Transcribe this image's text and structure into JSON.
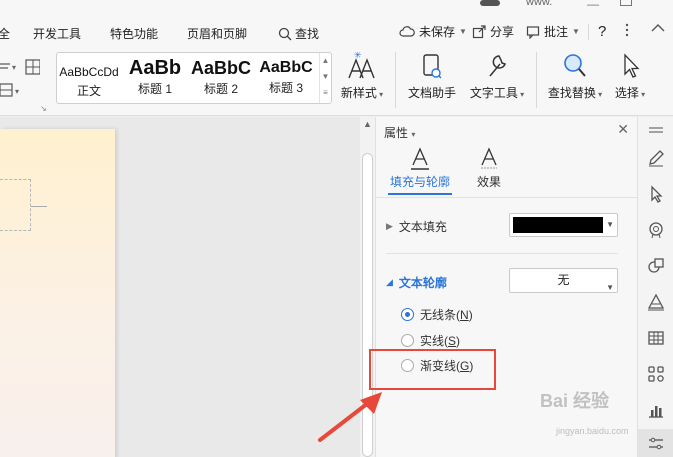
{
  "menu": {
    "partial_left": "全",
    "items": [
      "开发工具",
      "特色功能",
      "页眉和页脚"
    ],
    "search": "查找"
  },
  "title_strip": "www.",
  "toolbar_right": {
    "unsaved": "未保存",
    "share": "分享",
    "comment": "批注",
    "help": "?"
  },
  "style_gallery": [
    {
      "preview": "AaBbCcDd",
      "name": "正文"
    },
    {
      "preview": "AaBb",
      "name": "标题 1"
    },
    {
      "preview": "AaBbC",
      "name": "标题 2"
    },
    {
      "preview": "AaBbC",
      "name": "标题 3"
    }
  ],
  "ribbon": {
    "new_style": "新样式",
    "doc_assistant": "文档助手",
    "text_tools": "文字工具",
    "find_replace": "查找替换",
    "select": "选择"
  },
  "panel": {
    "title": "属性",
    "tabs": [
      "填充与轮廓",
      "效果"
    ],
    "text_fill": "文本填充",
    "fill_color": "#000000",
    "text_outline": "文本轮廓",
    "outline_value": "无",
    "radios": [
      {
        "label": "无线条",
        "key": "N",
        "checked": true
      },
      {
        "label": "实线",
        "key": "S",
        "checked": false
      },
      {
        "label": "渐变线",
        "key": "G",
        "checked": false
      }
    ]
  },
  "watermark": {
    "brand": "Bai  经验",
    "url": "jingyan.baidu.com"
  },
  "colors": {
    "accent": "#2b74d9",
    "highlight": "#e8483a"
  }
}
